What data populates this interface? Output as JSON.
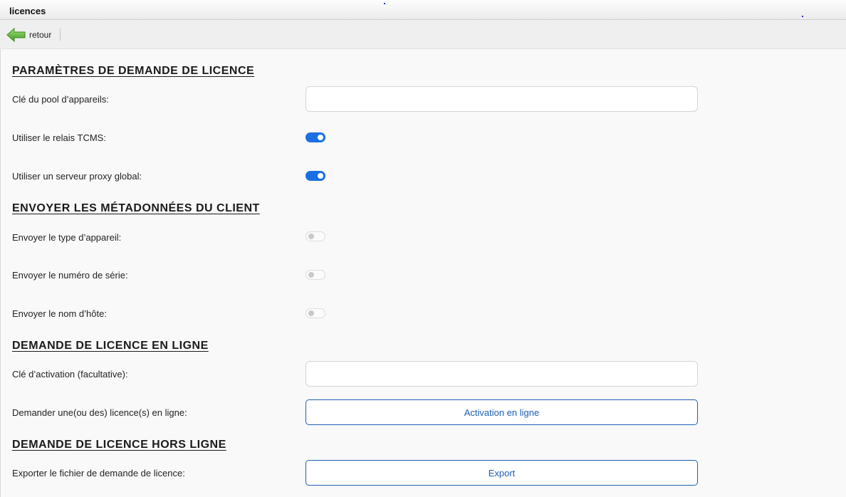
{
  "window": {
    "title": "licences"
  },
  "toolbar": {
    "back_label": "retour"
  },
  "sections": {
    "request_params": {
      "heading": "PARAMÈTRES DE DEMANDE DE LICENCE",
      "pool_key_label": "Clé du pool d’appareils:",
      "pool_key_value": "",
      "pool_key_placeholder": "",
      "tcms_relay_label": "Utiliser le relais TCMS:",
      "tcms_relay_on": true,
      "global_proxy_label": "Utiliser un serveur proxy global:",
      "global_proxy_on": true
    },
    "client_metadata": {
      "heading": "ENVOYER LES MÉTADONNÉES DU CLIENT",
      "device_type_label": "Envoyer le type d’appareil:",
      "device_type_on": false,
      "serial_number_label": "Envoyer le numéro de série:",
      "serial_number_on": false,
      "hostname_label": "Envoyer le nom d’hôte:",
      "hostname_on": false
    },
    "online_request": {
      "heading": "DEMANDE DE LICENCE EN LIGNE",
      "activation_key_label": "Clé d’activation (facultative):",
      "activation_key_value": "",
      "activation_key_placeholder": "",
      "request_online_label": "Demander une(ou des) licence(s) en ligne:",
      "activate_button_label": "Activation en ligne"
    },
    "offline_request": {
      "heading": "DEMANDE DE LICENCE HORS LIGNE",
      "export_label": "Exporter le fichier de demande de licence:",
      "export_button_label": "Export"
    }
  },
  "colors": {
    "accent": "#1a6fe3",
    "button_outline": "#1a5fb4",
    "toggle_off_knob": "#c9c9c9"
  },
  "icons": {
    "back": "green-left-arrow-icon"
  }
}
